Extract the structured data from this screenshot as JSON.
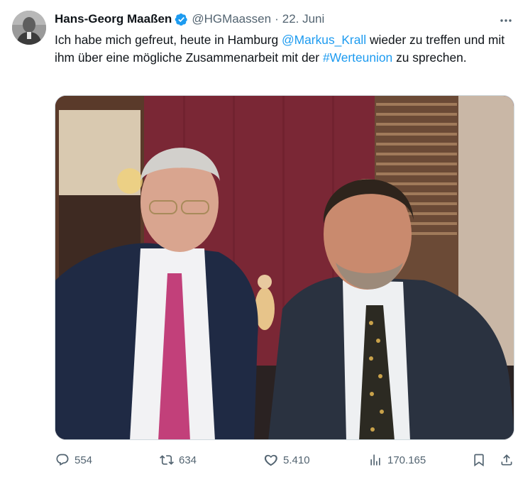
{
  "author": {
    "name": "Hans-Georg Maaßen",
    "handle": "@HGMaassen",
    "separator": "·",
    "date": "22. Juni",
    "verified_icon": "verified-badge-icon",
    "verified_color": "#1d9bf0"
  },
  "tweet": {
    "text_part1": "Ich habe mich gefreut, heute in Hamburg ",
    "mention": "@Markus_Krall",
    "text_part2": " wieder zu treffen und mit ihm über eine mögliche Zusammenarbeit mit der ",
    "hashtag": "#Werteunion",
    "text_part3": " zu sprechen."
  },
  "media": {
    "type": "photo"
  },
  "actions": {
    "replies": "554",
    "reposts": "634",
    "likes": "5.410",
    "views": "170.165",
    "icons": [
      "reply-icon",
      "repost-icon",
      "like-icon",
      "views-icon",
      "bookmark-icon",
      "share-icon"
    ]
  },
  "colors": {
    "link": "#1d9bf0",
    "secondary_text": "#536471",
    "primary_text": "#0f1419"
  }
}
